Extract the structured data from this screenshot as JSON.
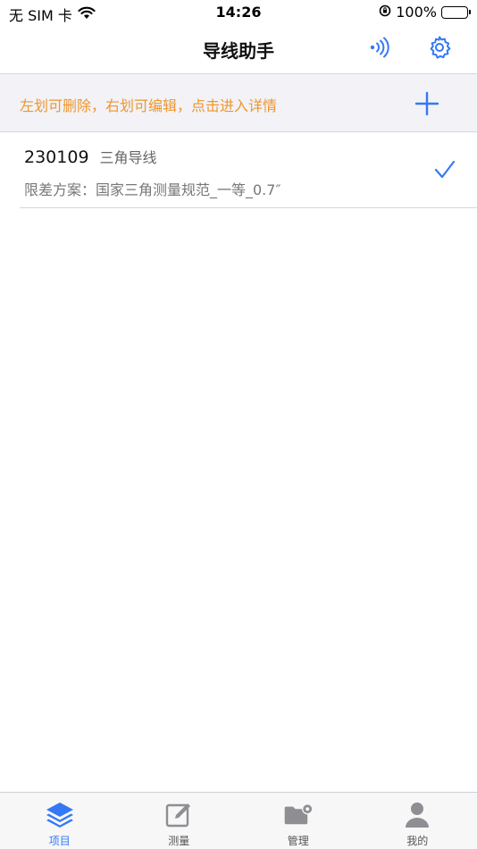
{
  "status_bar": {
    "carrier": "无 SIM 卡",
    "time": "14:26",
    "battery_percent": "100%",
    "battery_level": 1.0
  },
  "nav": {
    "title": "导线助手",
    "signal_icon": "bluetooth-signal-icon",
    "settings_icon": "gear-icon"
  },
  "hint": {
    "text": "左划可删除，右划可编辑，点击进入详情",
    "add_icon": "plus-icon"
  },
  "projects": [
    {
      "code": "230109",
      "type": "三角导线",
      "scheme": "限差方案：国家三角测量规范_一等_0.7″",
      "selected": true
    }
  ],
  "tabs": [
    {
      "label": "项目",
      "icon": "layers-icon",
      "active": true
    },
    {
      "label": "测量",
      "icon": "edit-icon",
      "active": false
    },
    {
      "label": "管理",
      "icon": "folder-gear-icon",
      "active": false
    },
    {
      "label": "我的",
      "icon": "user-icon",
      "active": false
    }
  ],
  "colors": {
    "accent": "#3478f6",
    "hint_text": "#f0962b",
    "hint_background": "#f2f2f7",
    "inactive_tab": "#8e8e93"
  }
}
